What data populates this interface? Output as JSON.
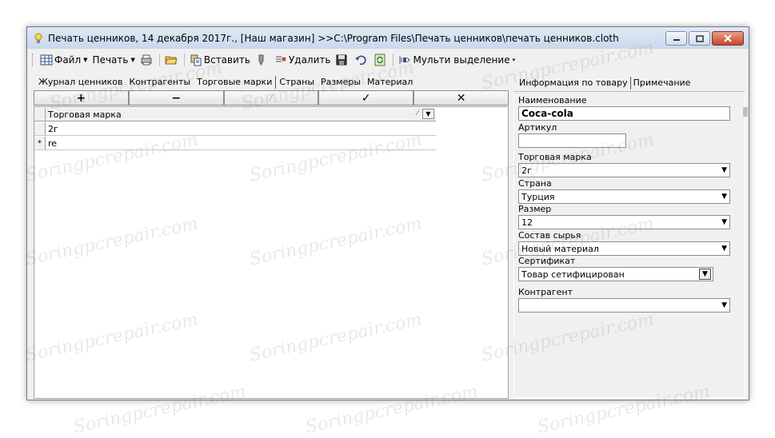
{
  "window": {
    "title": "Печать ценников, 14 декабря 2017г., [Наш магазин] >>C:\\Program Files\\Печать ценников\\печать ценников.cloth"
  },
  "toolbar": {
    "file_label": "Файл",
    "print_label": "Печать",
    "paste_label": "Вставить",
    "delete_label": "Удалить",
    "multi_select_label": "Мульти выделение"
  },
  "left_tabs": [
    "Журнал ценников",
    "Контрагенты",
    "Торговые марки",
    "Страны",
    "Размеры",
    "Материал"
  ],
  "grid_buttons": [
    "+",
    "−",
    "⁄",
    "✓",
    "✕"
  ],
  "grid": {
    "column_header": "Торговая марка",
    "rows": [
      {
        "indicator": "",
        "value": "2г"
      },
      {
        "indicator": "*",
        "value": "re"
      }
    ]
  },
  "right_tabs": [
    "Информация по товару",
    "Примечание"
  ],
  "product": {
    "name_label": "Наименование",
    "name_value": "Coca-cola",
    "article_label": "Артикул",
    "article_value": "",
    "brand_label": "Торговая марка",
    "brand_value": "2г",
    "country_label": "Страна",
    "country_value": "Турция",
    "size_label": "Размер",
    "size_value": "12",
    "material_label": "Состав сырья",
    "material_value": "Новый материал",
    "certificate_label": "Сертификат",
    "certificate_value": "Товар сетифицирован",
    "contractor_label": "Контрагент",
    "contractor_value": ""
  },
  "watermark_text": "Soringpcrepair.com"
}
